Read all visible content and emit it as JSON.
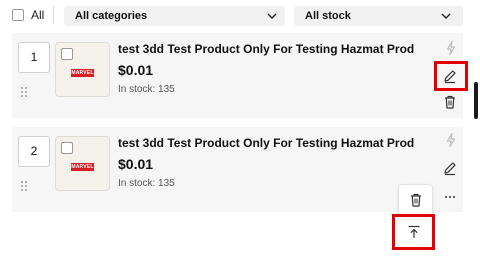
{
  "toolbar": {
    "select_all_label": "All",
    "category_filter": "All categories",
    "stock_filter": "All stock"
  },
  "products": [
    {
      "index": "1",
      "title": "test 3dd Test Product Only For Testing Hazmat Prod",
      "price": "$0.01",
      "stock": "In stock: 135",
      "brand_logo_text": "MARVEL"
    },
    {
      "index": "2",
      "title": "test 3dd Test Product Only For Testing Hazmat Prod",
      "price": "$0.01",
      "stock": "In stock: 135",
      "brand_logo_text": "MARVEL"
    }
  ],
  "actions": {
    "icons": [
      "lightning-icon",
      "edit-icon",
      "trash-icon",
      "more-icon",
      "move-to-top-icon"
    ]
  },
  "colors": {
    "highlight": "#e30000",
    "card_background": "#f6f6f6",
    "filter_background": "#f1f1f1"
  }
}
